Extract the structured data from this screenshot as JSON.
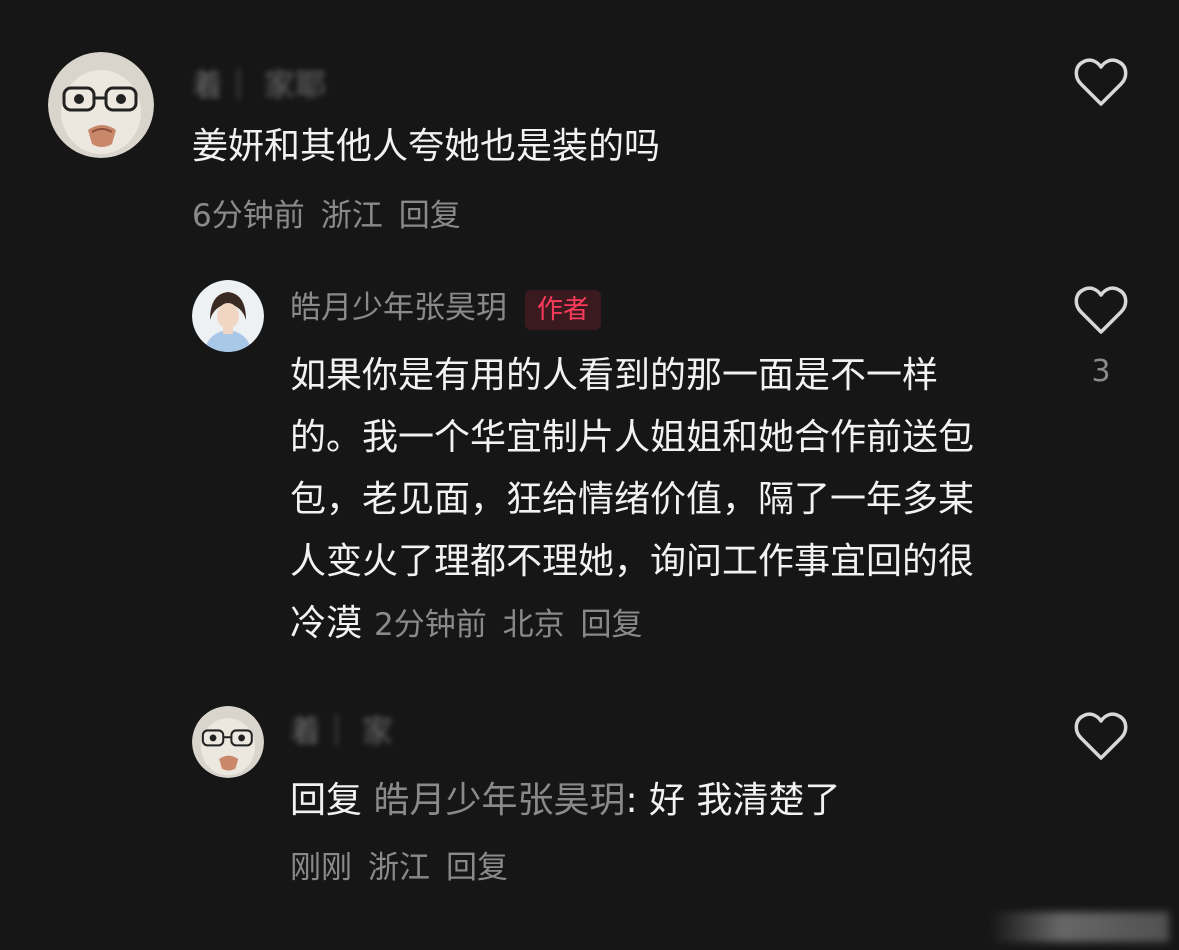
{
  "comments": [
    {
      "username": "着｜  家耶",
      "text": "姜妍和其他人夸她也是装的吗",
      "time": "6分钟前",
      "location": "浙江",
      "reply_label": "回复",
      "like_icon": "heart-outline-icon"
    },
    {
      "username": "皓月少年张昊玥",
      "badge": "作者",
      "text": "如果你是有用的人看到的那一面是不一样的。我一个华宜制片人姐姐和她合作前送包包，老见面，狂给情绪价值，隔了一年多某人变火了理都不理她，询问工作事宜回的很冷漠",
      "time": "2分钟前",
      "location": "北京",
      "reply_label": "回复",
      "like_count": "3",
      "like_icon": "heart-outline-icon"
    },
    {
      "username": "着｜  家",
      "reply_prefix": "回复",
      "reply_to": "皓月少年张昊玥",
      "text": ": 好 我清楚了",
      "time": "刚刚",
      "location": "浙江",
      "reply_label": "回复",
      "like_icon": "heart-outline-icon"
    }
  ],
  "colors": {
    "background": "#161616",
    "text_primary": "#f2f2f2",
    "text_secondary": "#8a8a8a",
    "badge_text": "#ff3b5c",
    "badge_bg": "#3a1a1e"
  }
}
